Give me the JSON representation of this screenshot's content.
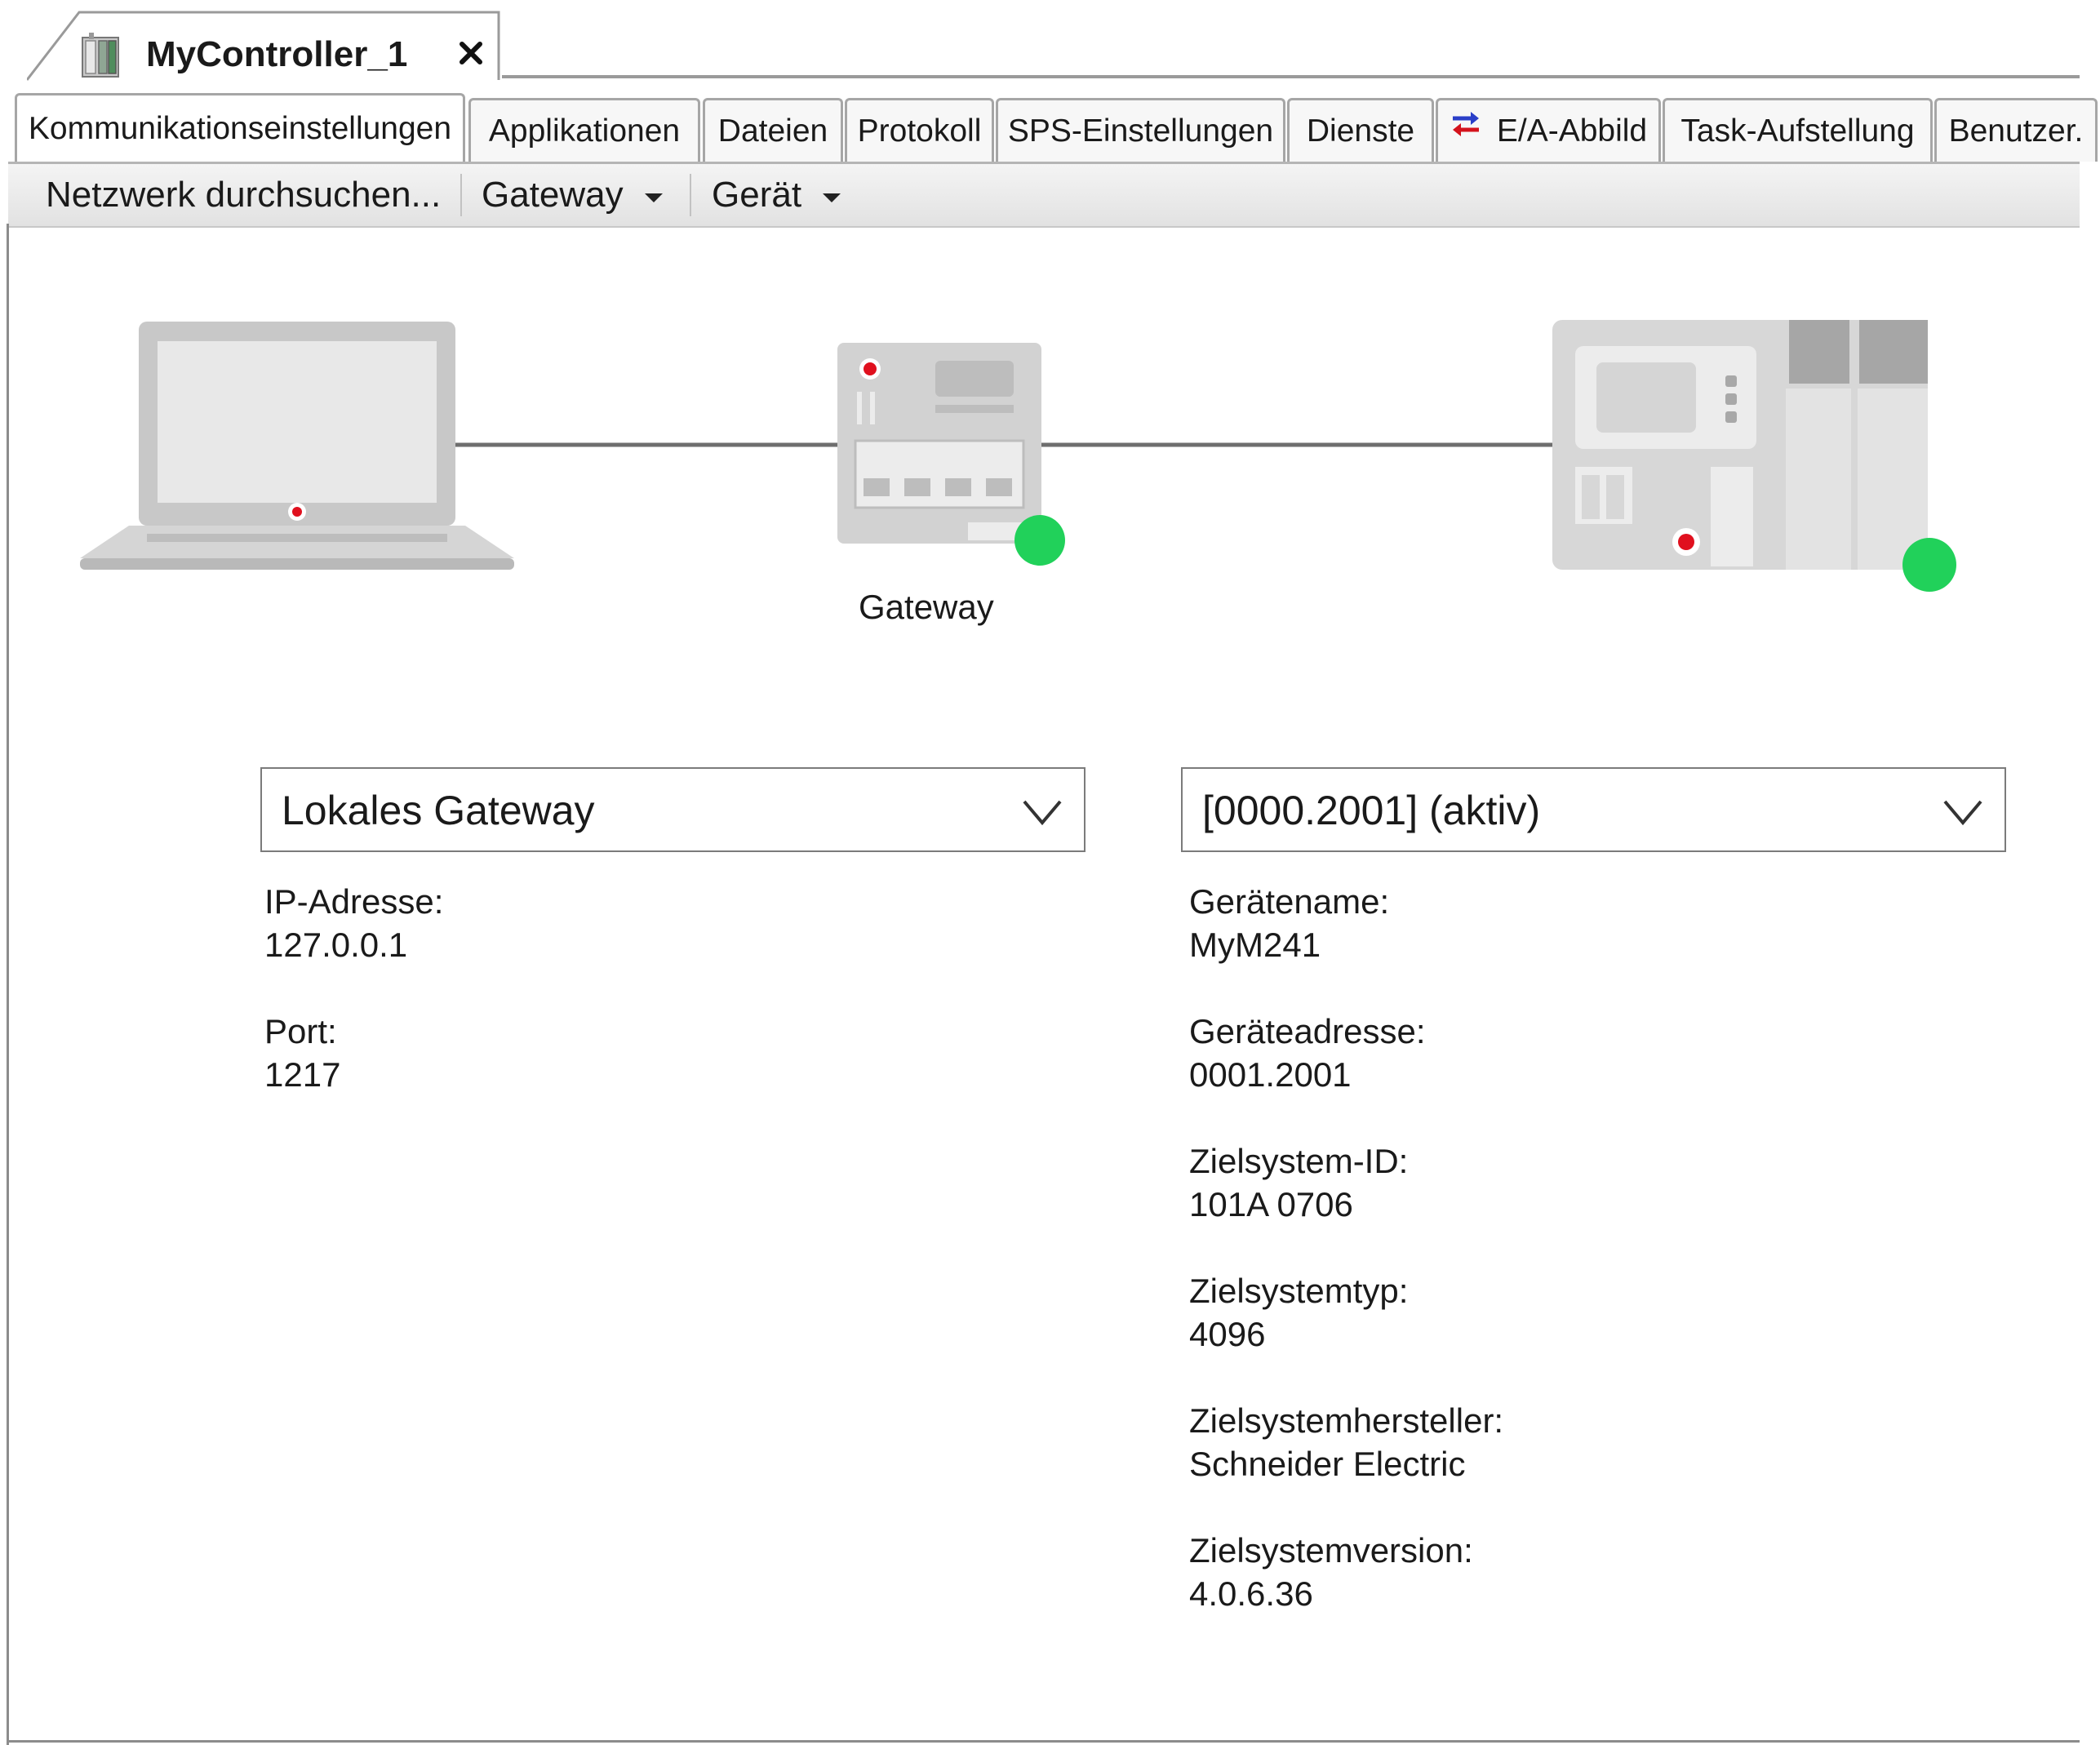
{
  "document_tab": {
    "title": "MyController_1",
    "icon": "controller-icon",
    "close_icon": "close-icon"
  },
  "subtabs": [
    {
      "label": "Kommunikationseinstellungen",
      "active": true
    },
    {
      "label": "Applikationen"
    },
    {
      "label": "Dateien"
    },
    {
      "label": "Protokoll"
    },
    {
      "label": "SPS-Einstellungen"
    },
    {
      "label": "Dienste"
    },
    {
      "label": "E/A-Abbild",
      "icon": "io-exchange-icon"
    },
    {
      "label": "Task-Aufstellung"
    },
    {
      "label": "Benutzer."
    }
  ],
  "toolbar": {
    "scan_network": "Netzwerk durchsuchen...",
    "gateway_menu": "Gateway",
    "device_menu": "Gerät"
  },
  "topology": {
    "gateway_label": "Gateway",
    "status_colors": {
      "online": "#21d15a",
      "indicator": "#e0101e"
    }
  },
  "gateway_panel": {
    "selected": "Lokales Gateway",
    "fields": [
      {
        "label": "IP-Adresse:",
        "value": "127.0.0.1"
      },
      {
        "label": "Port:",
        "value": "1217"
      }
    ]
  },
  "device_panel": {
    "selected": "[0000.2001] (aktiv)",
    "fields": [
      {
        "label": "Gerätename:",
        "value": "MyM241"
      },
      {
        "label": "Geräteadresse:",
        "value": "0001.2001"
      },
      {
        "label": "Zielsystem-ID:",
        "value": "101A 0706"
      },
      {
        "label": "Zielsystemtyp:",
        "value": "4096"
      },
      {
        "label": "Zielsystemhersteller:",
        "value": "Schneider Electric"
      },
      {
        "label": "Zielsystemversion:",
        "value": "4.0.6.36"
      }
    ]
  }
}
